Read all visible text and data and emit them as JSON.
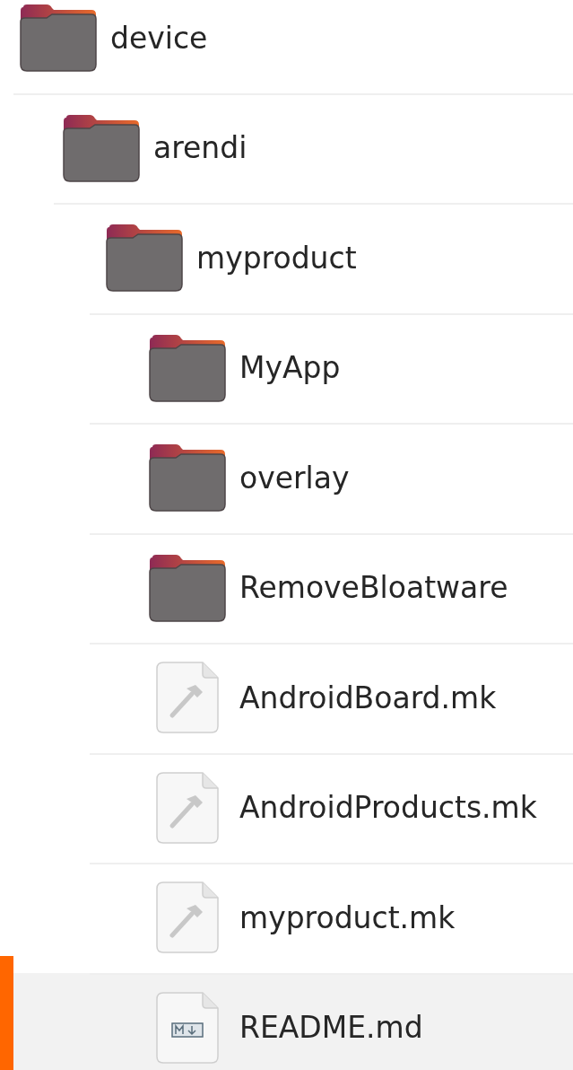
{
  "tree": [
    {
      "name": "device",
      "kind": "folder",
      "selected": false,
      "children": [
        {
          "name": "arendi",
          "kind": "folder",
          "selected": false,
          "children": [
            {
              "name": "myproduct",
              "kind": "folder",
              "selected": false,
              "children": [
                {
                  "name": "MyApp",
                  "kind": "folder",
                  "selected": false
                },
                {
                  "name": "overlay",
                  "kind": "folder",
                  "selected": false
                },
                {
                  "name": "RemoveBloatware",
                  "kind": "folder",
                  "selected": false
                },
                {
                  "name": "AndroidBoard.mk",
                  "kind": "makefile",
                  "selected": false
                },
                {
                  "name": "AndroidProducts.mk",
                  "kind": "makefile",
                  "selected": false
                },
                {
                  "name": "myproduct.mk",
                  "kind": "makefile",
                  "selected": false
                },
                {
                  "name": "README.md",
                  "kind": "markdown",
                  "selected": true
                }
              ]
            }
          ]
        }
      ]
    }
  ]
}
